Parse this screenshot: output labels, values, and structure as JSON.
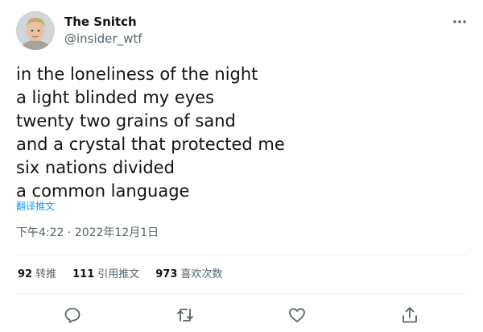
{
  "author": {
    "display_name": "The Snitch",
    "handle": "@insider_wtf",
    "avatar_icon": "avatar-photo"
  },
  "tweet": {
    "lines": [
      "in the loneliness of the night",
      "a light blinded my eyes",
      "twenty two grains of sand",
      "and a crystal that protected me",
      "six nations divided",
      "a common language"
    ],
    "translate_label": "翻译推文",
    "timestamp": "下午4:22 · 2022年12月1日"
  },
  "stats": {
    "retweets_count": "92",
    "retweets_label": "转推",
    "quotes_count": "111",
    "quotes_label": "引用推文",
    "likes_count": "973",
    "likes_label": "喜欢次数"
  },
  "actions": {
    "reply_icon": "reply-icon",
    "retweet_icon": "retweet-icon",
    "like_icon": "heart-icon",
    "share_icon": "share-icon"
  },
  "colors": {
    "link_blue": "#1d9bf0",
    "secondary_text": "#536471",
    "divider": "#eff3f4"
  }
}
